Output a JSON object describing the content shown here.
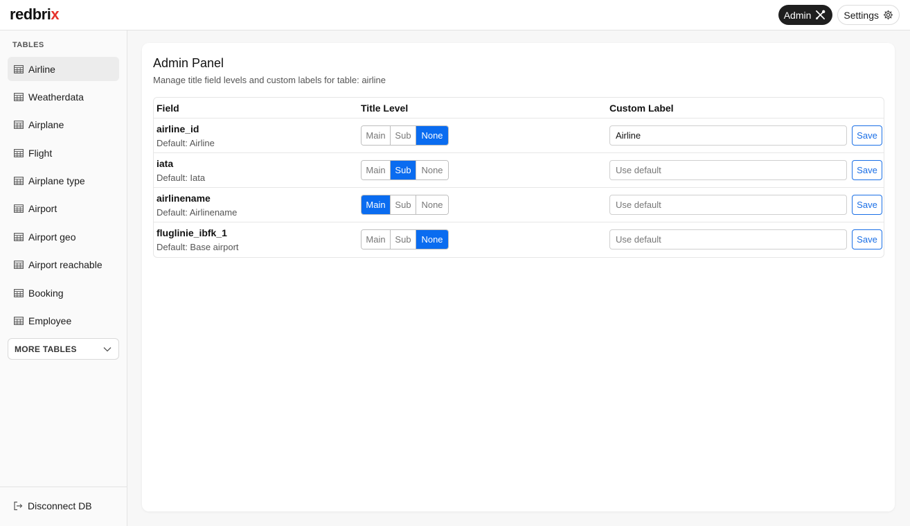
{
  "app": {
    "logo_main": "redbri",
    "logo_accent": "x",
    "accent_color": "#e5322d"
  },
  "header": {
    "admin_label": "Admin",
    "admin_icon": "wrench-screwdriver-icon",
    "settings_label": "Settings",
    "settings_icon": "gear-icon"
  },
  "sidebar": {
    "heading": "TABLES",
    "items": [
      {
        "label": "Airline",
        "active": true
      },
      {
        "label": "Weatherdata",
        "active": false
      },
      {
        "label": "Airplane",
        "active": false
      },
      {
        "label": "Flight",
        "active": false
      },
      {
        "label": "Airplane type",
        "active": false
      },
      {
        "label": "Airport",
        "active": false
      },
      {
        "label": "Airport geo",
        "active": false
      },
      {
        "label": "Airport reachable",
        "active": false
      },
      {
        "label": "Booking",
        "active": false
      },
      {
        "label": "Employee",
        "active": false
      }
    ],
    "more_tables": "MORE TABLES",
    "disconnect": "Disconnect DB"
  },
  "panel": {
    "title": "Admin Panel",
    "subtitle": "Manage title field levels and custom labels for table: airline",
    "columns": {
      "field": "Field",
      "title_level": "Title Level",
      "custom_label": "Custom Label"
    },
    "level_options": [
      "Main",
      "Sub",
      "None"
    ],
    "placeholder": "Use default",
    "save_label": "Save",
    "selected_color": "#0a6cf0",
    "rows": [
      {
        "name": "airline_id",
        "default": "Default: Airline",
        "level": "None",
        "label_value": "Airline"
      },
      {
        "name": "iata",
        "default": "Default: Iata",
        "level": "Sub",
        "label_value": ""
      },
      {
        "name": "airlinename",
        "default": "Default: Airlinename",
        "level": "Main",
        "label_value": ""
      },
      {
        "name": "fluglinie_ibfk_1",
        "default": "Default: Base airport",
        "level": "None",
        "label_value": ""
      }
    ]
  }
}
